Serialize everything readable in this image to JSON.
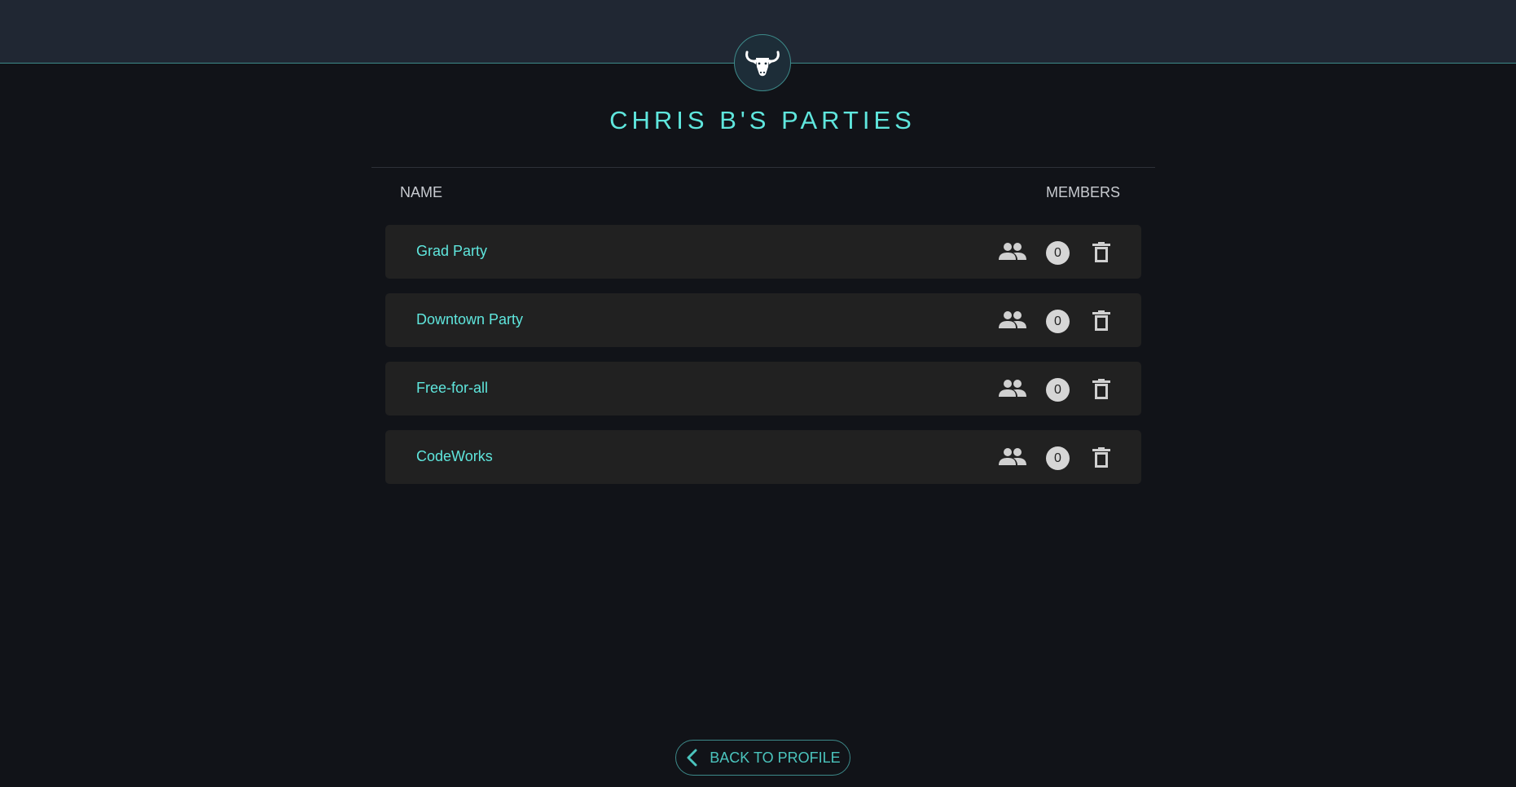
{
  "header": {
    "logo_icon": "bull-head-icon",
    "page_title": "CHRIS B'S PARTIES"
  },
  "table": {
    "columns": {
      "name": "NAME",
      "members": "MEMBERS"
    },
    "rows": [
      {
        "name": "Grad Party",
        "members_icon": "people-icon",
        "count": "0",
        "delete_icon": "trash-icon"
      },
      {
        "name": "Downtown Party",
        "members_icon": "people-icon",
        "count": "0",
        "delete_icon": "trash-icon"
      },
      {
        "name": "Free-for-all",
        "members_icon": "people-icon",
        "count": "0",
        "delete_icon": "trash-icon"
      },
      {
        "name": "CodeWorks",
        "members_icon": "people-icon",
        "count": "0",
        "delete_icon": "trash-icon"
      }
    ]
  },
  "footer": {
    "back_label": "BACK TO PROFILE",
    "back_icon": "chevron-left-icon"
  },
  "colors": {
    "accent": "#5fe6dd",
    "background": "#111318",
    "topbar": "#202733",
    "row_bg": "#212121",
    "border_accent": "#3d8a8a"
  }
}
